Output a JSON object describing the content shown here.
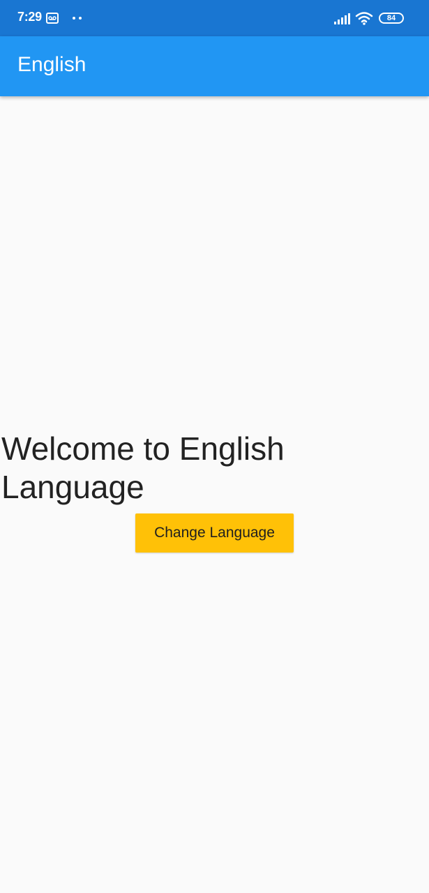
{
  "status_bar": {
    "time": "7:29",
    "battery_level": "84",
    "icons": [
      "voicemail-icon",
      "notification-dots-icon",
      "signal-icon",
      "wifi-icon",
      "battery-icon"
    ]
  },
  "app_bar": {
    "title": "English"
  },
  "main": {
    "welcome_text": "Welcome to English Language",
    "change_language_label": "Change Language"
  },
  "colors": {
    "status_bar": "#1976d2",
    "app_bar": "#2196f3",
    "background": "#fafafa",
    "button": "#ffc107",
    "text": "#222222"
  }
}
